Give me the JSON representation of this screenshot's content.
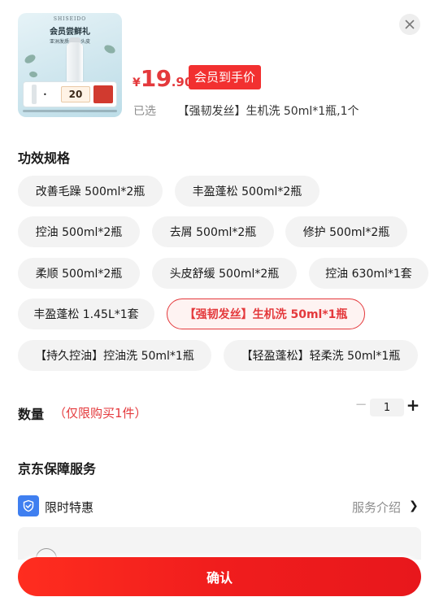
{
  "product": {
    "thumb": {
      "brand": "SHISEIDO",
      "title": "会员尝鲜礼",
      "subtitle": "亚洲发质 强韧头皮",
      "coupon": "20"
    },
    "price": {
      "currency": "¥",
      "integer": "19",
      "decimal": ".90"
    },
    "member_tag": "会员到手价",
    "selected_label": "已选",
    "selected_value": "【强韧发丝】生机洗 50ml*1瓶,1个"
  },
  "close_icon": "close-icon",
  "spec": {
    "title": "功效规格",
    "options": [
      {
        "label": "改善毛躁 500ml*2瓶",
        "active": false
      },
      {
        "label": "丰盈蓬松 500ml*2瓶",
        "active": false
      },
      {
        "label": "控油 500ml*2瓶",
        "active": false
      },
      {
        "label": "去屑 500ml*2瓶",
        "active": false
      },
      {
        "label": "修护 500ml*2瓶",
        "active": false
      },
      {
        "label": "柔顺 500ml*2瓶",
        "active": false
      },
      {
        "label": "头皮舒缓 500ml*2瓶",
        "active": false
      },
      {
        "label": "控油 630ml*1套",
        "active": false
      },
      {
        "label": "丰盈蓬松 1.45L*1套",
        "active": false
      },
      {
        "label": "【强韧发丝】生机洗 50ml*1瓶",
        "active": true
      },
      {
        "label": "【持久控油】控油洗 50ml*1瓶",
        "active": false
      },
      {
        "label": "【轻盈蓬松】轻柔洗 50ml*1瓶",
        "active": false
      }
    ]
  },
  "quantity": {
    "label": "数量",
    "limit": "（仅限购买1件）",
    "minus": "−",
    "value": "1",
    "plus": "+"
  },
  "service": {
    "title": "京东保障服务",
    "item_name": "限时特惠",
    "intro_link": "服务介绍",
    "chevron": "❯"
  },
  "confirm_label": "确认",
  "colors": {
    "accent": "#e4393c",
    "button": "#f01d1d",
    "service_icon": "#3f7ff0"
  }
}
